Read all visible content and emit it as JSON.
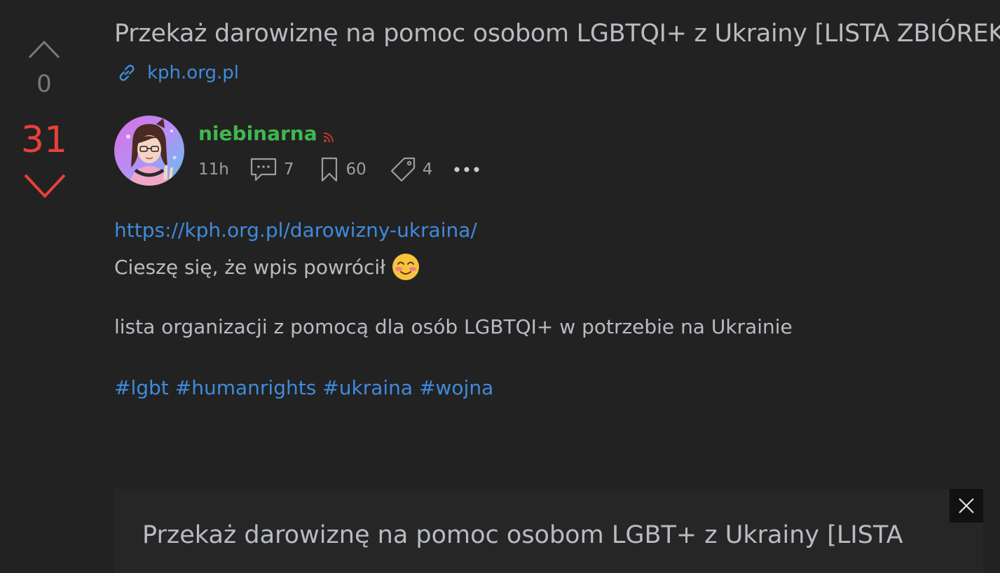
{
  "vote": {
    "up_count": "0",
    "down_count": "31"
  },
  "post": {
    "title": "Przekaż darowiznę na pomoc osobom LGBTQI+ z Ukrainy [LISTA ZBIÓREK]",
    "source_domain": "kph.org.pl",
    "author": "niebinarna",
    "time": "11h",
    "comments": "7",
    "saves": "60",
    "tags_count": "4",
    "url_text": "https://kph.org.pl/darowizny-ukraina/",
    "line2": "Cieszę się, że wpis powrócił",
    "line3": "lista organizacji z pomocą dla osób LGBTQI+ w potrzebie na Ukrainie",
    "hashtags": [
      "#lgbt",
      "#humanrights",
      "#ukraina",
      "#wojna"
    ]
  },
  "preview": {
    "title": "Przekaż darowiznę na pomoc osobom LGBT+ z Ukrainy [LISTA"
  },
  "icons": {
    "vote_up": "chevron-up-icon",
    "vote_down": "chevron-down-icon",
    "link": "link-icon",
    "rss": "rss-icon",
    "comments": "comment-icon",
    "saves": "bookmark-icon",
    "tags": "tag-icon",
    "more": "more-icon",
    "emoji": "smiling-face-icon",
    "close": "close-icon"
  },
  "colors": {
    "background": "#222222",
    "text": "#b8bcc2",
    "link": "#3f8bdc",
    "author": "#3fb74f",
    "downvote": "#e8413a",
    "muted": "#7a7a7a"
  }
}
